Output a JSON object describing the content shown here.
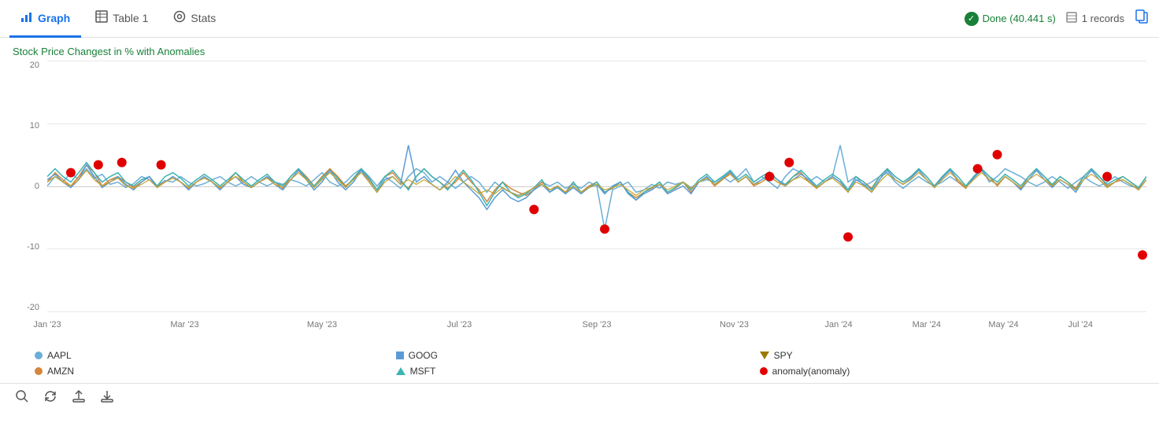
{
  "tabs": [
    {
      "id": "graph",
      "label": "Graph",
      "icon": "📊",
      "active": true
    },
    {
      "id": "table1",
      "label": "Table 1",
      "icon": "⊞",
      "active": false
    },
    {
      "id": "stats",
      "label": "Stats",
      "icon": "◎",
      "active": false
    }
  ],
  "status": {
    "done_label": "Done (40.441 s)",
    "records_label": "1 records"
  },
  "chart": {
    "title": "Stock Price Changest in % with Anomalies",
    "y_labels": [
      "20",
      "10",
      "0",
      "-10",
      "-20"
    ],
    "x_labels": [
      {
        "label": "Jan '23",
        "pct": 0
      },
      {
        "label": "Mar '23",
        "pct": 12.5
      },
      {
        "label": "May '23",
        "pct": 25
      },
      {
        "label": "Jul '23",
        "pct": 37.5
      },
      {
        "label": "Sep '23",
        "pct": 50
      },
      {
        "label": "Nov '23",
        "pct": 62.5
      },
      {
        "label": "Jan '24",
        "pct": 75
      },
      {
        "label": "Mar '24",
        "pct": 81.25
      },
      {
        "label": "May '24",
        "pct": 87.5
      },
      {
        "label": "Jul '24",
        "pct": 93.75
      }
    ]
  },
  "legend": [
    {
      "id": "aapl",
      "label": "AAPL",
      "type": "dot",
      "color": "#6baed6"
    },
    {
      "id": "goog",
      "label": "GOOG",
      "type": "square",
      "color": "#5b9bd5"
    },
    {
      "id": "spy",
      "label": "SPY",
      "type": "triangle",
      "color": "#9b7a00"
    },
    {
      "id": "amzn",
      "label": "AMZN",
      "type": "dot",
      "color": "#d6863b"
    },
    {
      "id": "msft",
      "label": "MSFT",
      "type": "triangle-up",
      "color": "#3cb4b4"
    },
    {
      "id": "anomaly",
      "label": "anomaly(anomaly)",
      "type": "dot",
      "color": "#e00000"
    }
  ],
  "toolbar": {
    "search_label": "search",
    "refresh_label": "refresh",
    "upload_label": "upload",
    "download_label": "download"
  }
}
